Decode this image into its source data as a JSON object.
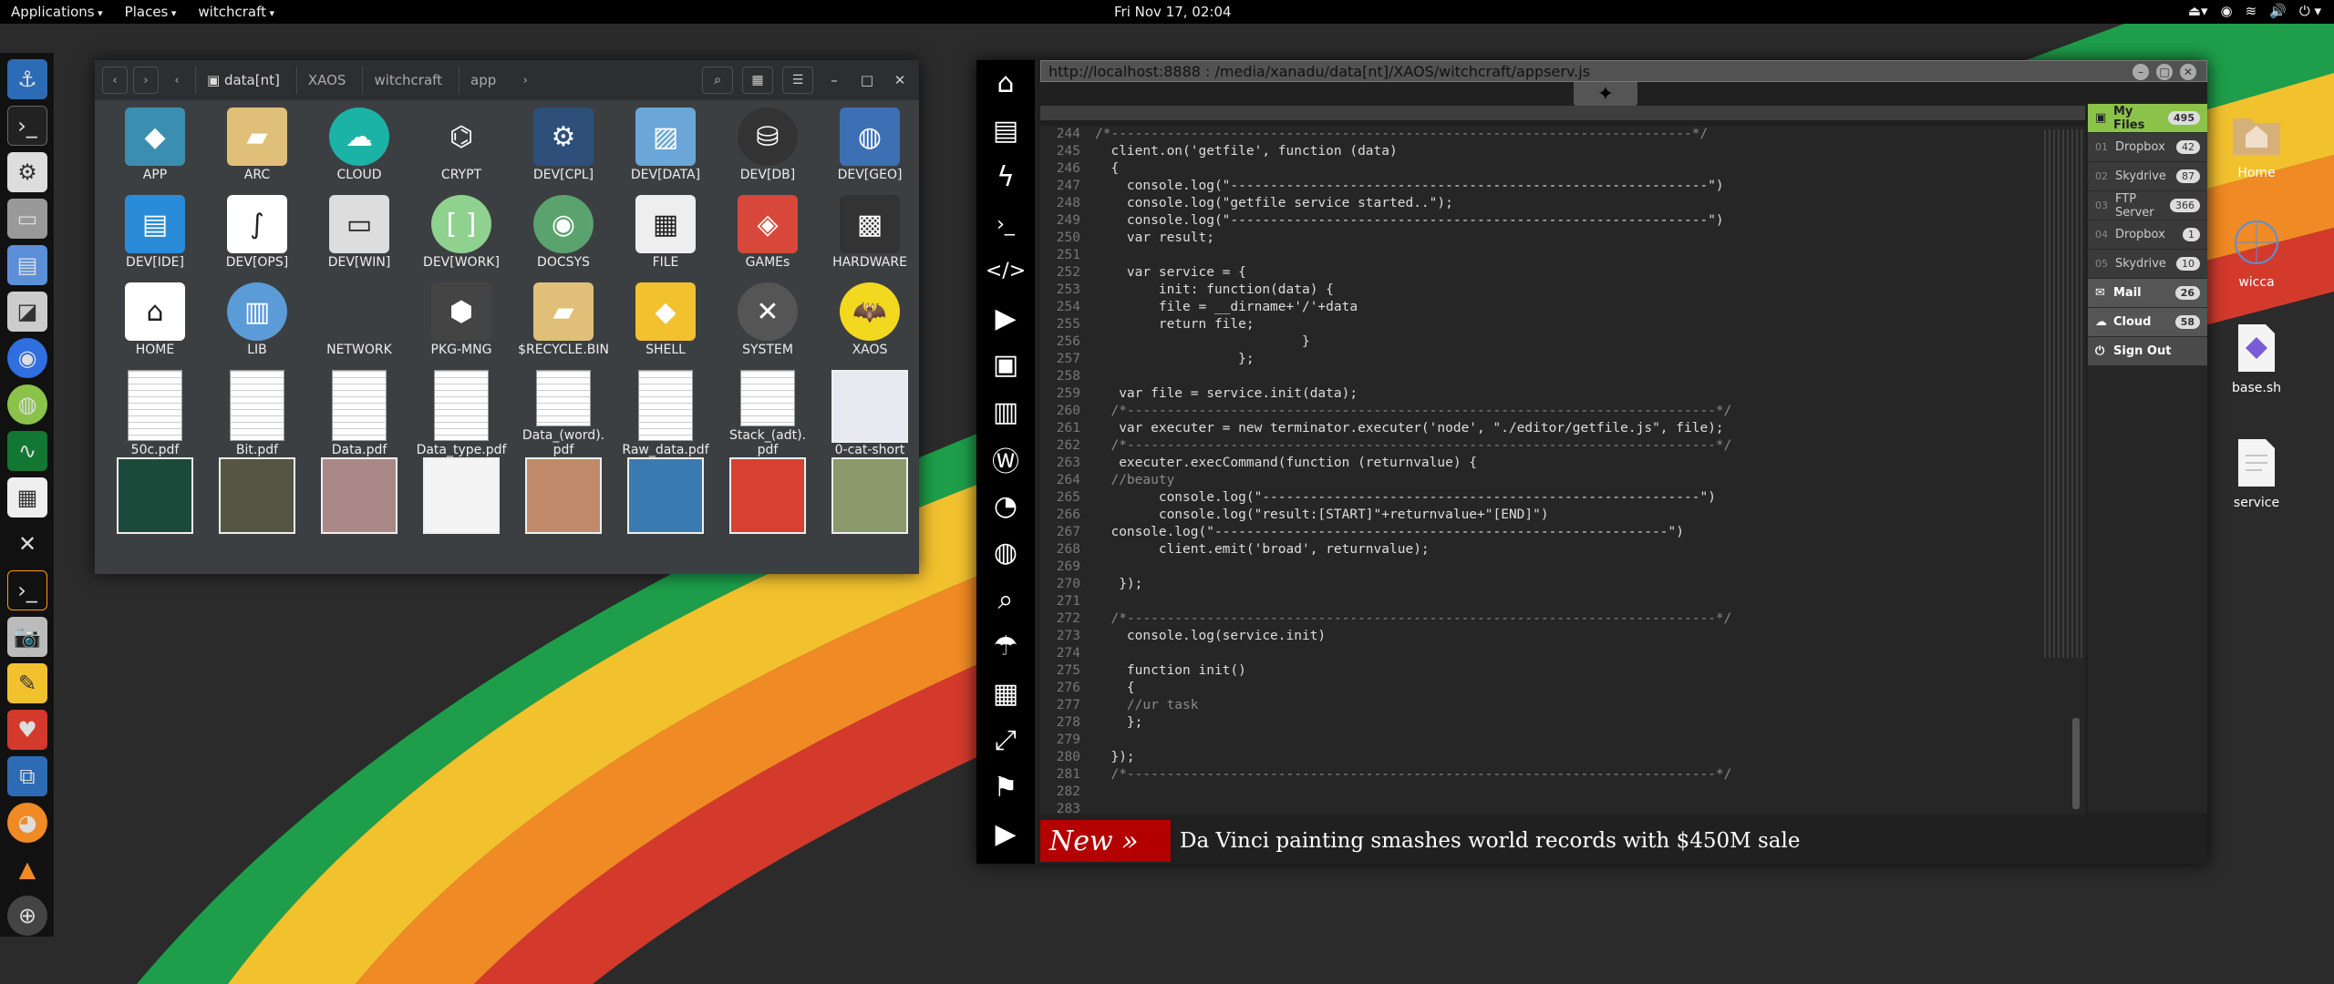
{
  "topbar": {
    "menus": [
      "Applications",
      "Places",
      "witchcraft"
    ],
    "clock": "Fri Nov 17, 02:04"
  },
  "file_manager": {
    "breadcrumbs": [
      "data[nt]",
      "XAOS",
      "witchcraft",
      "app"
    ],
    "items": [
      {
        "label": "APP",
        "icon": "box-icon",
        "kind": "folder-icon"
      },
      {
        "label": "ARC",
        "icon": "folder-icon",
        "kind": "folder"
      },
      {
        "label": "CLOUD",
        "icon": "cloud-icon",
        "kind": "folder"
      },
      {
        "label": "CRYPT",
        "icon": "crypt-icon",
        "kind": "folder"
      },
      {
        "label": "DEV[CPL]",
        "icon": "gear-icon",
        "kind": "folder"
      },
      {
        "label": "DEV[DATA]",
        "icon": "map-icon",
        "kind": "folder"
      },
      {
        "label": "DEV[DB]",
        "icon": "database-icon",
        "kind": "folder"
      },
      {
        "label": "DEV[GEO]",
        "icon": "globe-icon",
        "kind": "folder"
      },
      {
        "label": "DEV[IDE]",
        "icon": "ide-icon",
        "kind": "folder"
      },
      {
        "label": "DEV[OPS]",
        "icon": "math-icon",
        "kind": "folder"
      },
      {
        "label": "DEV[WIN]",
        "icon": "window-icon",
        "kind": "folder"
      },
      {
        "label": "DEV[WORK]",
        "icon": "brackets-icon",
        "kind": "folder"
      },
      {
        "label": "DOCSYS",
        "icon": "docs-icon",
        "kind": "folder"
      },
      {
        "label": "FILE",
        "icon": "hex-icon",
        "kind": "folder"
      },
      {
        "label": "GAMEs",
        "icon": "games-icon",
        "kind": "folder"
      },
      {
        "label": "HARDWARE",
        "icon": "chip-icon",
        "kind": "folder"
      },
      {
        "label": "HOME",
        "icon": "home-icon",
        "kind": "folder"
      },
      {
        "label": "LIB",
        "icon": "books-icon",
        "kind": "folder"
      },
      {
        "label": "NETWORK",
        "icon": "network-icon",
        "kind": "folder"
      },
      {
        "label": "PKG-MNG",
        "icon": "package-icon",
        "kind": "folder"
      },
      {
        "label": "$RECYCLE.BIN",
        "icon": "folder-icon",
        "kind": "folder"
      },
      {
        "label": "SHELL",
        "icon": "shell-icon",
        "kind": "folder"
      },
      {
        "label": "SYSTEM",
        "icon": "system-icon",
        "kind": "folder"
      },
      {
        "label": "XAOS",
        "icon": "batman-icon",
        "kind": "folder"
      },
      {
        "label": "50c.pdf",
        "icon": "pdf-icon",
        "kind": "doc"
      },
      {
        "label": "Bit.pdf",
        "icon": "pdf-icon",
        "kind": "doc"
      },
      {
        "label": "Data.pdf",
        "icon": "pdf-icon",
        "kind": "doc"
      },
      {
        "label": "Data_type.pdf",
        "icon": "pdf-icon",
        "kind": "doc"
      },
      {
        "label": "Data_(word).\npdf",
        "icon": "pdf-icon",
        "kind": "doc"
      },
      {
        "label": "Raw_data.pdf",
        "icon": "pdf-icon",
        "kind": "doc"
      },
      {
        "label": "Stack_(adt).\npdf",
        "icon": "pdf-icon",
        "kind": "doc"
      },
      {
        "label": "0-cat-short",
        "icon": "image-icon",
        "kind": "img"
      },
      {
        "label": "",
        "icon": "image-icon",
        "kind": "img"
      },
      {
        "label": "",
        "icon": "image-icon",
        "kind": "img"
      },
      {
        "label": "",
        "icon": "image-icon",
        "kind": "img"
      },
      {
        "label": "",
        "icon": "image-icon",
        "kind": "img"
      },
      {
        "label": "",
        "icon": "image-icon",
        "kind": "img"
      },
      {
        "label": "",
        "icon": "image-icon",
        "kind": "img"
      },
      {
        "label": "",
        "icon": "image-icon",
        "kind": "img"
      },
      {
        "label": "",
        "icon": "image-icon",
        "kind": "img"
      }
    ]
  },
  "editor": {
    "url": "http://localhost:8888 : /media/xanadu/data[nt]/XAOS/witchcraft/appserv.js",
    "first_line": 244,
    "lines": [
      "/*-------------------------------------------------------------------------*/",
      "  client.on('getfile', function (data)",
      "  {",
      "    console.log(\"------------------------------------------------------------\")",
      "    console.log(\"getfile service started..\");",
      "    console.log(\"------------------------------------------------------------\")",
      "    var result;",
      "",
      "    var service = {",
      "        init: function(data) {",
      "        file = __dirname+'/'+data",
      "        return file;",
      "                          }",
      "                  };",
      "",
      "   var file = service.init(data);",
      "  /*--------------------------------------------------------------------------*/",
      "   var executer = new terminator.executer('node', \"./editor/getfile.js\", file);",
      "  /*--------------------------------------------------------------------------*/",
      "   executer.execCommand(function (returnvalue) {",
      "  //beauty",
      "        console.log(\"-------------------------------------------------------\")",
      "        console.log(\"result:[START]\"+returnvalue+\"[END]\")",
      "  console.log(\"---------------------------------------------------------\")",
      "        client.emit('broad', returnvalue);",
      "",
      "   });",
      "",
      "  /*--------------------------------------------------------------------------*/",
      "    console.log(service.init)",
      "",
      "    function init()",
      "    {",
      "    //ur task",
      "    };",
      "",
      "  });",
      "  /*--------------------------------------------------------------------------*/",
      "",
      ""
    ],
    "ticker_label": "New »",
    "ticker_text": "Da Vinci painting smashes world records with $450M sale",
    "sidebar_icons": [
      "home-icon",
      "document-icon",
      "bolt-icon",
      "terminal-icon",
      "code-icon",
      "play-icon",
      "image-icon",
      "newspaper-icon",
      "wordpress-icon",
      "wechat-icon",
      "globe-icon",
      "search-icon",
      "umbrella-icon",
      "contact-icon",
      "expand-icon",
      "flag-icon",
      "youtube-icon"
    ]
  },
  "files_panel": {
    "items": [
      {
        "num": "",
        "label": "My Files",
        "count": "495",
        "style": "main"
      },
      {
        "num": "01",
        "label": "Dropbox",
        "count": "42",
        "style": "sub"
      },
      {
        "num": "02",
        "label": "Skydrive",
        "count": "87",
        "style": "sub"
      },
      {
        "num": "03",
        "label": "FTP Server",
        "count": "366",
        "style": "sub"
      },
      {
        "num": "04",
        "label": "Dropbox",
        "count": "1",
        "style": "sub"
      },
      {
        "num": "05",
        "label": "Skydrive",
        "count": "10",
        "style": "sub"
      },
      {
        "num": "",
        "label": "Mail",
        "count": "26",
        "style": "sec"
      },
      {
        "num": "",
        "label": "Cloud",
        "count": "58",
        "style": "sec"
      },
      {
        "num": "",
        "label": "Sign Out",
        "count": "",
        "style": "out"
      }
    ]
  },
  "desktop_icons": [
    "Home",
    "wicca",
    "base.sh",
    "service"
  ],
  "colors": {
    "accent": "#8bc34a",
    "ticker_red": "#b30000",
    "stripe_green": "#1e9e4a",
    "stripe_yellow": "#f2c12e",
    "stripe_orange": "#f08a24",
    "stripe_red": "#d33a2c"
  }
}
